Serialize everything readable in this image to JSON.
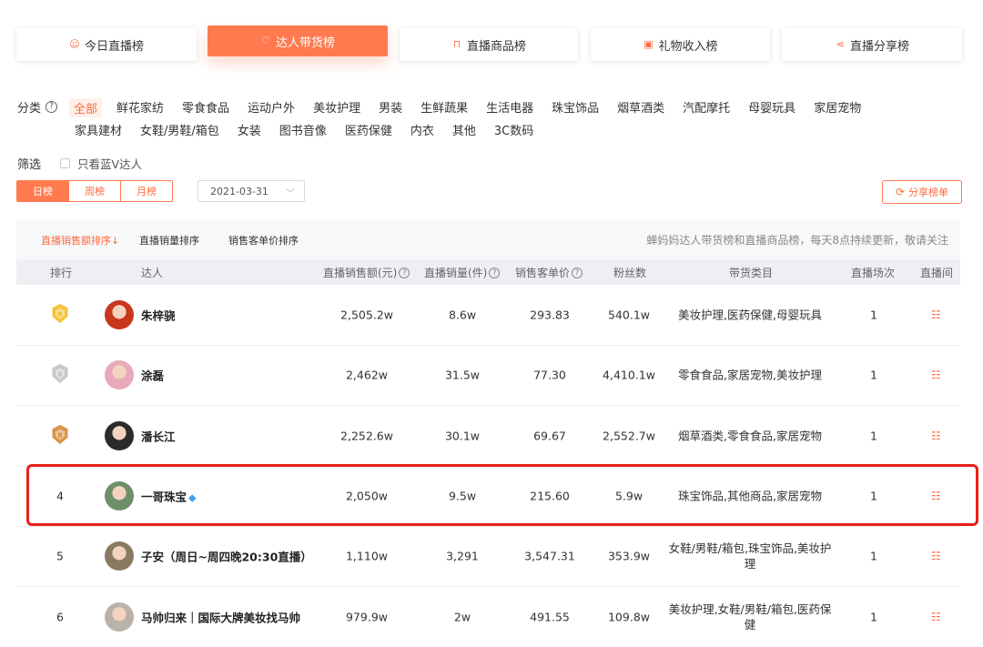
{
  "tabs": [
    {
      "label": "今日直播榜",
      "icon": "smile-circle-icon"
    },
    {
      "label": "达人带货榜",
      "icon": "heart-shield-icon",
      "active": true
    },
    {
      "label": "直播商品榜",
      "icon": "shopping-bag-icon"
    },
    {
      "label": "礼物收入榜",
      "icon": "gift-icon"
    },
    {
      "label": "直播分享榜",
      "icon": "share-icon"
    }
  ],
  "category": {
    "label": "分类",
    "row1": [
      "全部",
      "鲜花家纺",
      "零食食品",
      "运动户外",
      "美妆护理",
      "男装",
      "生鲜蔬果",
      "生活电器",
      "珠宝饰品",
      "烟草酒类",
      "汽配摩托",
      "母婴玩具",
      "家居宠物"
    ],
    "row2": [
      "家具建材",
      "女鞋/男鞋/箱包",
      "女装",
      "图书音像",
      "医药保健",
      "内衣",
      "其他",
      "3C数码"
    ]
  },
  "filter": {
    "label": "筛选",
    "blue_v": "只看蓝V达人"
  },
  "period": [
    "日榜",
    "周榜",
    "月榜"
  ],
  "date": "2021-03-31",
  "share_button": "分享榜单",
  "sort": {
    "options": [
      "直播销售额排序",
      "直播销量排序",
      "销售客单价排序"
    ],
    "active_suffix": "↓",
    "note": "蝉妈妈达人带货榜和直播商品榜，每天8点持续更新，敬请关注"
  },
  "columns": [
    "排行",
    "达人",
    "直播销售额(元)",
    "直播销量(件)",
    "销售客单价",
    "粉丝数",
    "带货类目",
    "直播场次",
    "直播间"
  ],
  "rows": [
    {
      "rank": "",
      "medal": "gold",
      "name": "朱梓骁",
      "sales": "2,505.2w",
      "volume": "8.6w",
      "price": "293.83",
      "fans": "540.1w",
      "cats": "美妆护理,医药保健,母婴玩具",
      "sessions": "1",
      "avatar_color": "#c8361e"
    },
    {
      "rank": "",
      "medal": "silver",
      "name": "涂磊",
      "sales": "2,462w",
      "volume": "31.5w",
      "price": "77.30",
      "fans": "4,410.1w",
      "cats": "零食食品,家居宠物,美妆护理",
      "sessions": "1",
      "avatar_color": "#e8a9b8"
    },
    {
      "rank": "",
      "medal": "bronze",
      "name": "潘长江",
      "sales": "2,252.6w",
      "volume": "30.1w",
      "price": "69.67",
      "fans": "2,552.7w",
      "cats": "烟草酒类,零食食品,家居宠物",
      "sessions": "1",
      "avatar_color": "#2b2b2b"
    },
    {
      "rank": "4",
      "medal": "",
      "name": "一哥珠宝",
      "verified": true,
      "sales": "2,050w",
      "volume": "9.5w",
      "price": "215.60",
      "fans": "5.9w",
      "cats": "珠宝饰品,其他商品,家居宠物",
      "sessions": "1",
      "avatar_color": "#6f8f6a"
    },
    {
      "rank": "5",
      "medal": "",
      "name": "子安（周日~周四晚20:30直播）",
      "sales": "1,110w",
      "volume": "3,291",
      "price": "3,547.31",
      "fans": "353.9w",
      "cats": "女鞋/男鞋/箱包,珠宝饰品,美妆护理",
      "sessions": "1",
      "avatar_color": "#8a7a62"
    },
    {
      "rank": "6",
      "medal": "",
      "name": "马帅归来｜国际大牌美妆找马帅",
      "sales": "979.9w",
      "volume": "2w",
      "price": "491.55",
      "fans": "109.8w",
      "cats": "美妆护理,女鞋/男鞋/箱包,医药保健",
      "sessions": "1",
      "avatar_color": "#b9b2aa"
    }
  ],
  "colors": {
    "accent": "#ff7a4f",
    "highlight": "#e8201a",
    "gold": "#f5c33b",
    "silver": "#c9c9c9",
    "bronze": "#d9954a"
  }
}
